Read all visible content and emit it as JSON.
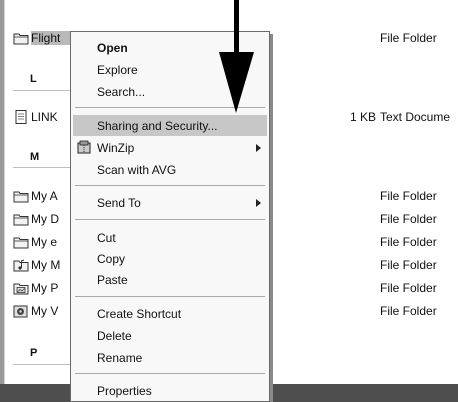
{
  "files": [
    {
      "name": "Flight ",
      "size": "",
      "type": "File Folder",
      "icon": "folder-icon",
      "selected": true
    },
    {
      "name": "LINK",
      "size": "1 KB",
      "type": "Text Docume",
      "icon": "text-file-icon",
      "selected": false
    },
    {
      "name": "My A",
      "size": "",
      "type": "File Folder",
      "icon": "folder-icon",
      "selected": false
    },
    {
      "name": "My D",
      "size": "",
      "type": "File Folder",
      "icon": "folder-icon",
      "selected": false
    },
    {
      "name": "My e",
      "size": "",
      "type": "File Folder",
      "icon": "folder-icon",
      "selected": false
    },
    {
      "name": "My M",
      "size": "",
      "type": "File Folder",
      "icon": "music-folder-icon",
      "selected": false
    },
    {
      "name": "My P",
      "size": "",
      "type": "File Folder",
      "icon": "pictures-folder-icon",
      "selected": false
    },
    {
      "name": "My V",
      "size": "",
      "type": "File Folder",
      "icon": "video-folder-icon",
      "selected": false
    }
  ],
  "groups": [
    "L",
    "M",
    "P"
  ],
  "context_menu": {
    "open": "Open",
    "explore": "Explore",
    "search": "Search...",
    "sharing": "Sharing and Security...",
    "winzip": "WinZip",
    "scan": "Scan with AVG",
    "send_to": "Send To",
    "cut": "Cut",
    "copy": "Copy",
    "paste": "Paste",
    "create_shortcut": "Create Shortcut",
    "delete": "Delete",
    "rename": "Rename",
    "properties": "Properties",
    "highlighted_item": "Sharing and Security..."
  },
  "colors": {
    "selection": "#b9b9b9",
    "menu_highlight": "#c7c7c7",
    "taskbar": "#4e4e4e",
    "arrow": "#000000"
  },
  "icons": {
    "folder": "folder-icon",
    "text_file": "text-file-icon",
    "winzip": "winzip-icon",
    "submenu": "submenu-arrow-icon",
    "pointer": "pointer-arrow-icon"
  }
}
